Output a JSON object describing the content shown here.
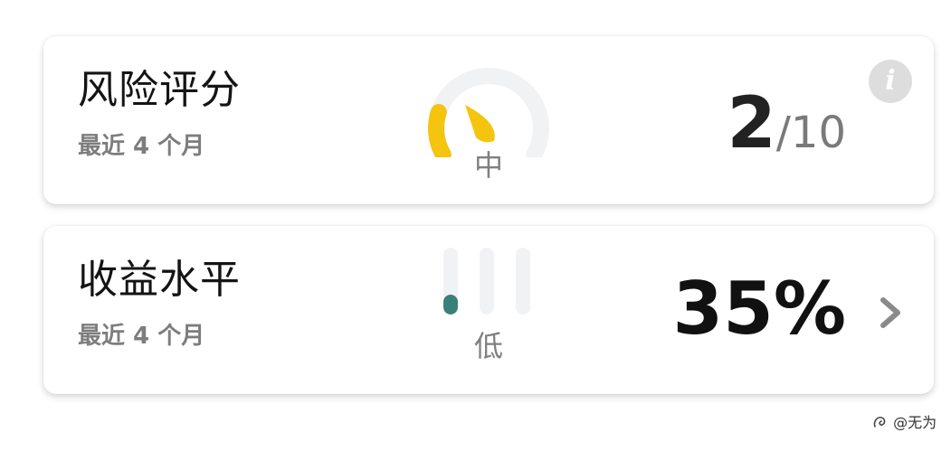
{
  "risk_card": {
    "title": "风险评分",
    "subtitle": "最近 4 个月",
    "gauge_fraction": 0.2,
    "level": "中",
    "score": "2",
    "score_max": "/10",
    "info_icon": "i",
    "colors": {
      "gauge_fill": "#f4c40f",
      "gauge_track": "#f1f2f4"
    }
  },
  "return_card": {
    "title": "收益水平",
    "subtitle": "最近 4 个月",
    "bar_levels": [
      0.3,
      0,
      0
    ],
    "level": "低",
    "percent": "35%",
    "colors": {
      "bar_fill": "#3b8078",
      "bar_track": "#f1f2f4"
    }
  },
  "watermark": "@无为",
  "icons": [
    "info-icon",
    "gauge-needle-icon",
    "chevron-right-icon",
    "watermark-logo-icon"
  ]
}
